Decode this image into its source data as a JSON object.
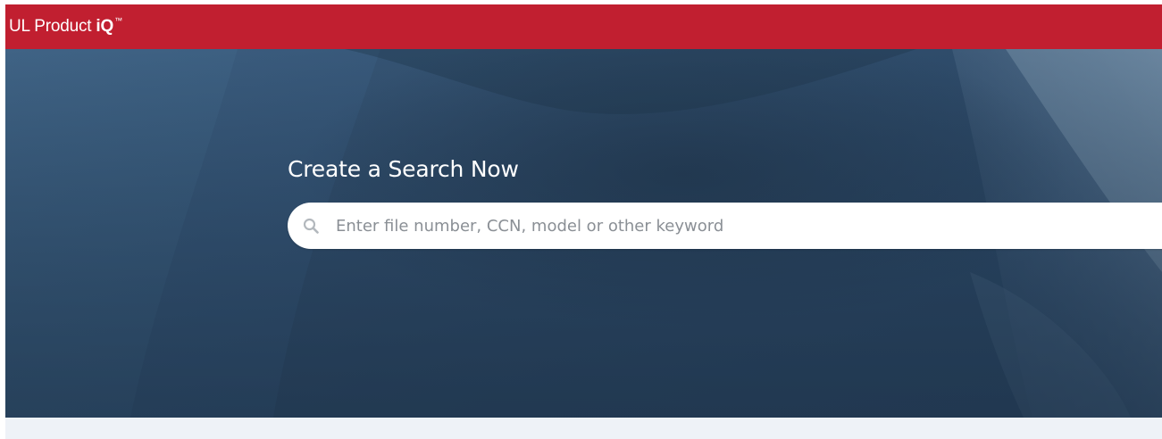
{
  "header": {
    "brand_text": "UL Product ",
    "brand_strong": "iQ",
    "brand_tm": "™",
    "background_color": "#c11f30"
  },
  "hero": {
    "title": "Create a Search Now",
    "background_color": "#263f5a"
  },
  "search": {
    "placeholder": "Enter file number, CCN, model or other keyword",
    "value": "",
    "icon": "search-icon"
  }
}
